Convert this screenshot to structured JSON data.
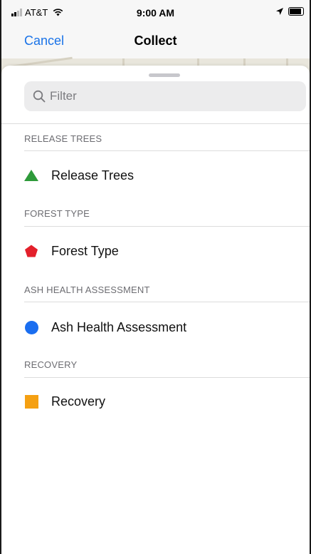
{
  "status_bar": {
    "carrier": "AT&T",
    "time": "9:00 AM",
    "battery_level": 0.9
  },
  "nav": {
    "cancel_label": "Cancel",
    "title": "Collect"
  },
  "filter": {
    "placeholder": "Filter"
  },
  "sections": [
    {
      "header": "RELEASE TREES",
      "item": "Release Trees",
      "symbol": "green-triangle",
      "color": "#2e9a3a"
    },
    {
      "header": "FOREST TYPE",
      "item": "Forest Type",
      "symbol": "red-pentagon",
      "color": "#e3202b"
    },
    {
      "header": "ASH HEALTH ASSESSMENT",
      "item": "Ash Health Assessment",
      "symbol": "blue-circle",
      "color": "#1a6ef0"
    },
    {
      "header": "RECOVERY",
      "item": "Recovery",
      "symbol": "orange-square",
      "color": "#f5a012"
    }
  ]
}
